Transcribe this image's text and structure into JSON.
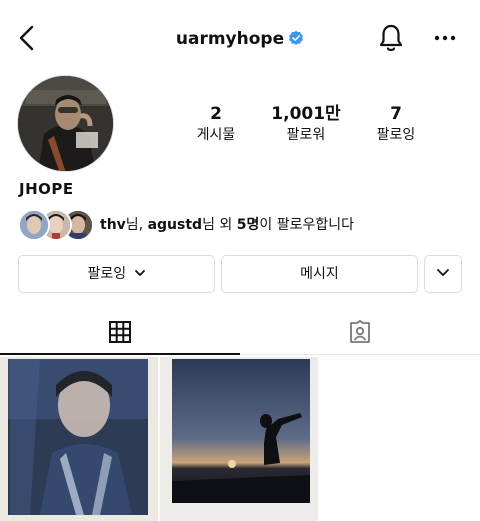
{
  "header": {
    "username": "uarmyhope",
    "icons": {
      "back": "chevron-left-icon",
      "verified": "verified-badge-icon",
      "notifications": "bell-icon",
      "more": "more-horizontal-icon"
    },
    "accent_color": "#3897f0"
  },
  "profile": {
    "display_name": "JHOPE",
    "stats": {
      "posts": {
        "value": "2",
        "label": "게시물"
      },
      "followers": {
        "value": "1,001만",
        "label": "팔로워"
      },
      "following": {
        "value": "7",
        "label": "팔로잉"
      }
    }
  },
  "followed_by": {
    "user1": "thv",
    "sep1": "님, ",
    "user2": "agustd",
    "sep2": "님 외 ",
    "count": "5명",
    "suffix": "이 팔로우합니다"
  },
  "actions": {
    "following_label": "팔로잉",
    "message_label": "메시지",
    "icons": {
      "following_dropdown": "chevron-down-icon",
      "suggested": "chevron-down-icon"
    }
  },
  "tabs": {
    "icons": [
      "grid-icon",
      "tagged-person-icon"
    ]
  }
}
